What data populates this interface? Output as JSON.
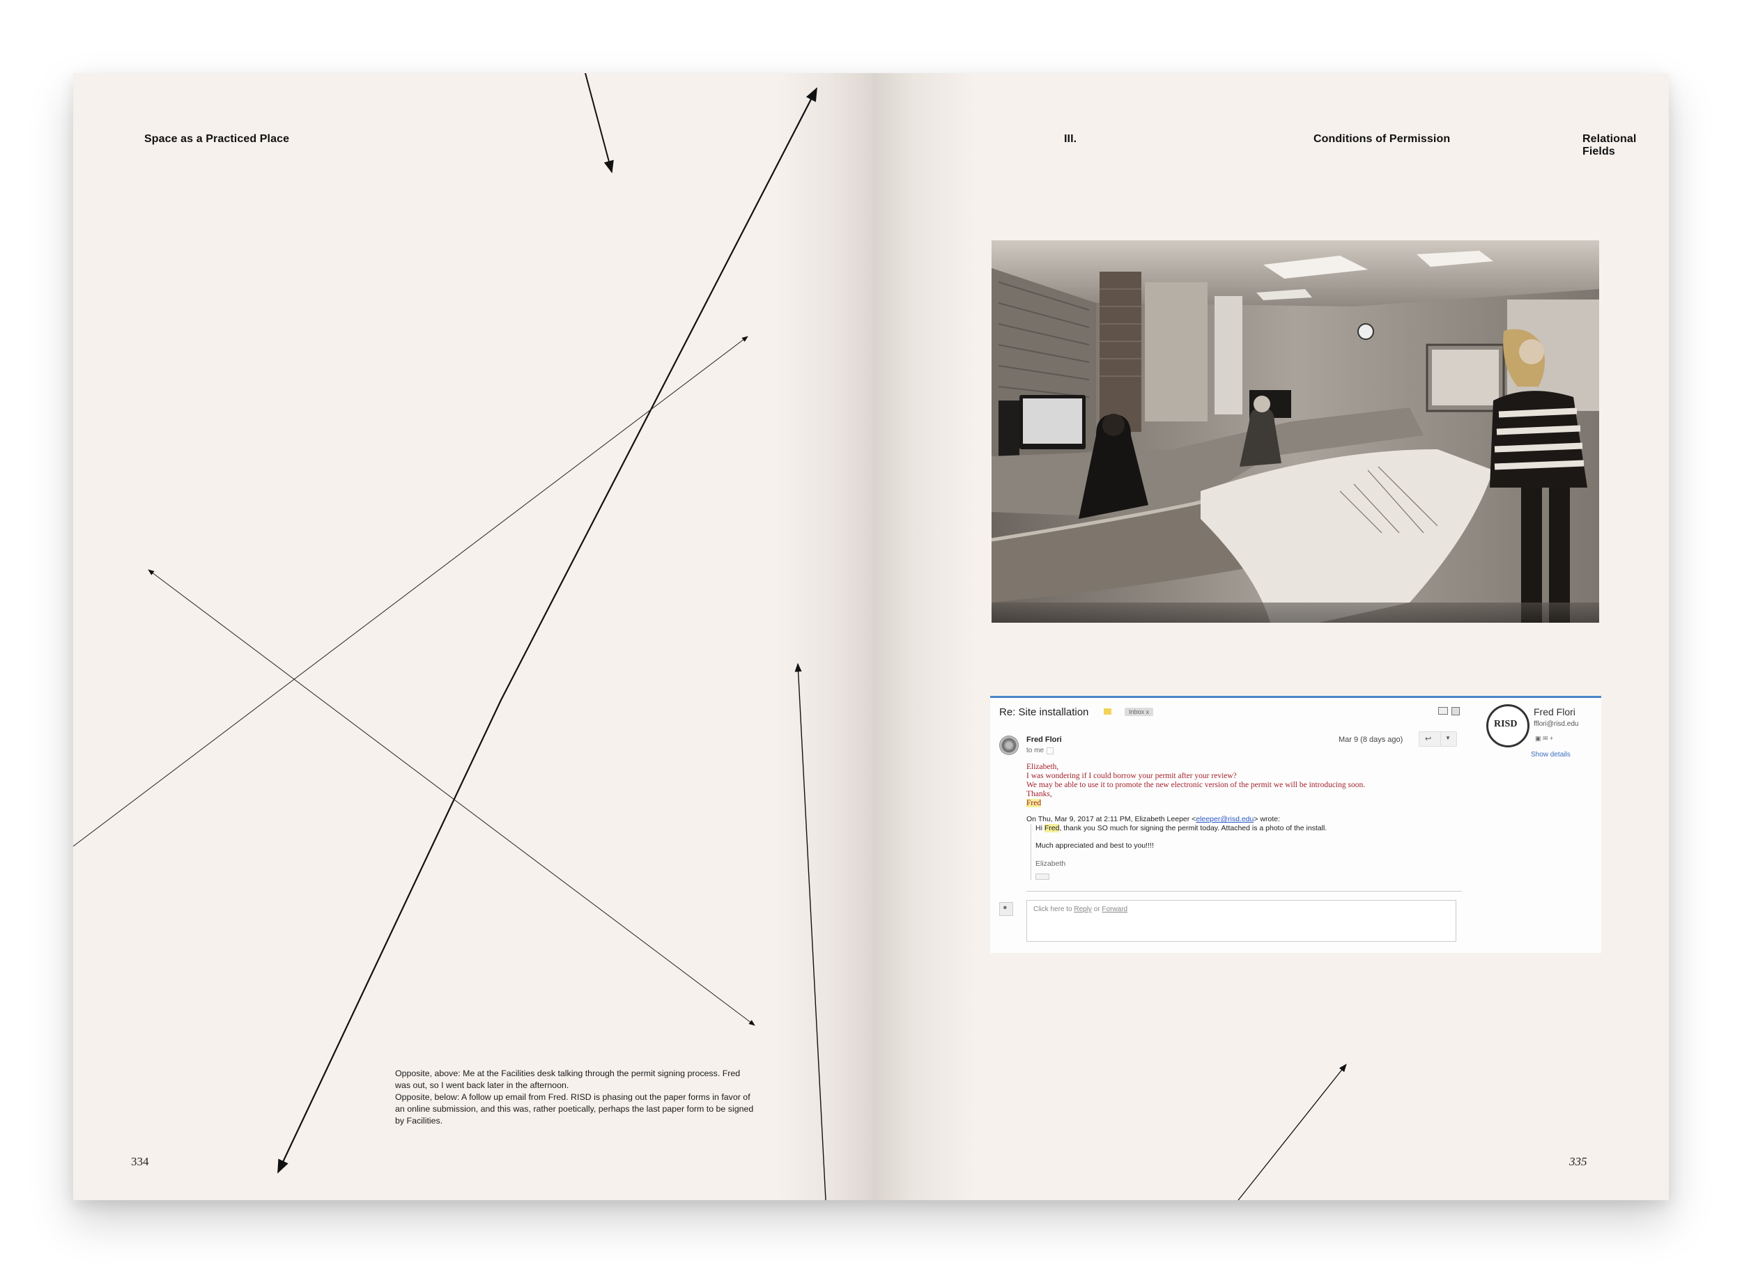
{
  "left_page": {
    "running_head": "Space as a Practiced Place",
    "folio": "334",
    "caption": [
      "Opposite, above: Me at the Facilities desk talking through the permit signing process. Fred was out, so I went back later in the afternoon.",
      "Opposite, below: A follow up email from Fred. RISD is phasing out the paper forms in favor of an online submission, and this was, rather poetically, perhaps the last paper form to be signed by Facilities."
    ]
  },
  "right_page": {
    "running_head_left": "III.",
    "running_head_center": "Conditions of Permission",
    "running_head_right": "Relational Fields",
    "folio": "335"
  },
  "email": {
    "subject": "Re: Site installation",
    "label": "Inbox x",
    "sender_name": "Fred Flori",
    "recipient": "to me",
    "date": "Mar 9 (8 days ago)",
    "body_lines": [
      "Elizabeth,",
      "I was wondering if I could borrow your permit after your review?",
      "We may be able to use it to promote the new electronic version of the permit we will be introducing soon.",
      "Thanks,"
    ],
    "signature": "Fred",
    "quote_header_pre": "On Thu, Mar 9, 2017 at 2:11 PM, Elizabeth Leeper <",
    "quote_header_link": "eleeper@risd.edu",
    "quote_header_post": "> wrote:",
    "quote_greeting": "Hi",
    "quote_name": "Fred",
    "quote_rest": ", thank you SO much for signing the permit today. Attached is a photo of the install.",
    "quote_line2": "Much appreciated and best to you!!!!",
    "quote_sign": "Elizabeth",
    "reply_prefix": "Click here to",
    "reply_word": "Reply",
    "reply_or": "or",
    "forward_word": "Forward",
    "profile_name": "Fred Flori",
    "profile_email": "fflori@risd.edu",
    "profile_logo": "RISD",
    "show_details": "Show details",
    "icons": [
      "print-icon",
      "new-window-icon",
      "reply-icon",
      "more-icon",
      "person-icon"
    ]
  },
  "colors": {
    "paper": "#f6f1ed",
    "ink": "#111111",
    "email_red": "#a3222c",
    "gmail_blue": "#4a86c8"
  }
}
